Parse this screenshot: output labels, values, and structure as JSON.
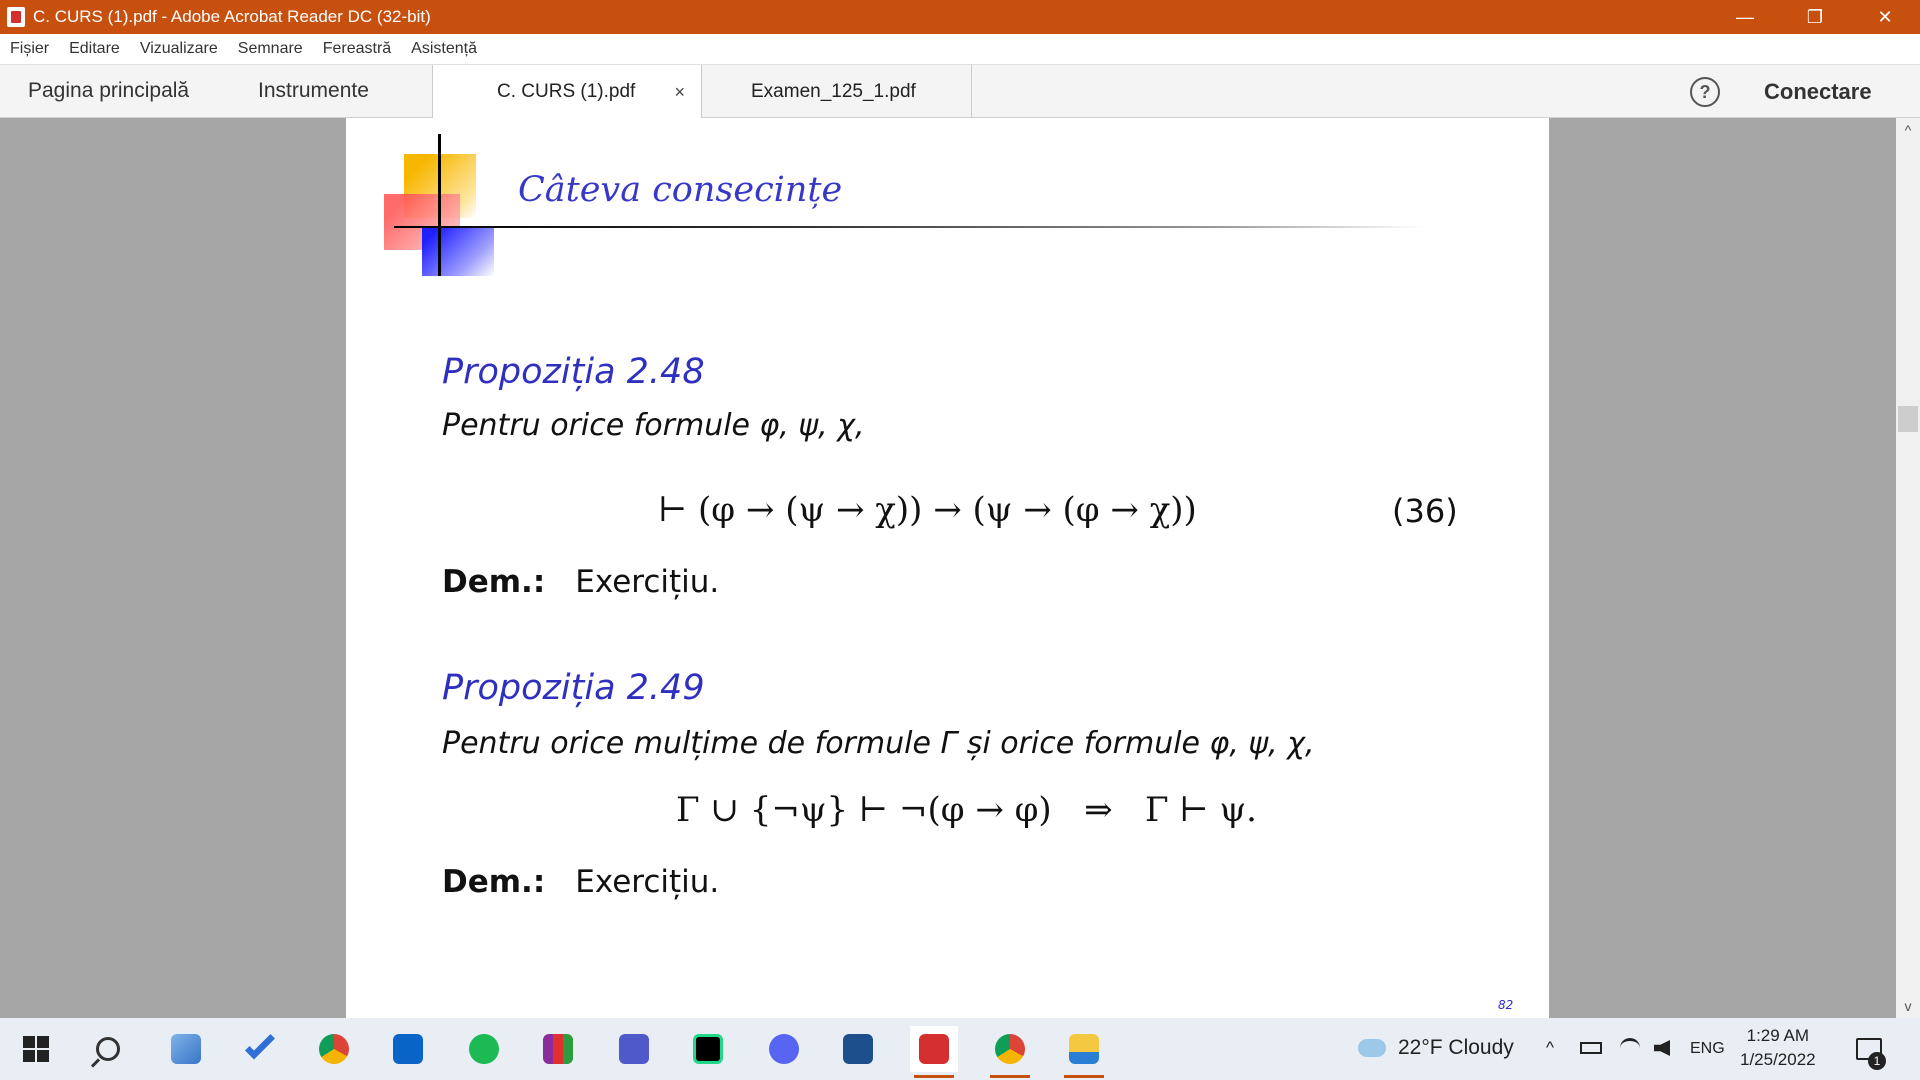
{
  "window": {
    "title": "C. CURS (1).pdf - Adobe Acrobat Reader DC (32-bit)",
    "min": "—",
    "max": "❐",
    "close": "✕"
  },
  "menu": [
    "Fișier",
    "Editare",
    "Vizualizare",
    "Semnare",
    "Fereastră",
    "Asistență"
  ],
  "tabs": {
    "home": "Pagina principală",
    "tools": "Instrumente",
    "documents": [
      {
        "label": "C. CURS (1).pdf",
        "active": true
      },
      {
        "label": "Examen_125_1.pdf",
        "active": false
      }
    ],
    "close_glyph": "×",
    "help": "?",
    "signin": "Conectare"
  },
  "slide": {
    "title": "Câteva consecințe",
    "prop1": {
      "title": "Propoziția 2.48",
      "text": "Pentru orice formule φ, ψ, χ,",
      "formula": "⊢ (φ → (ψ → χ)) → (ψ → (φ → χ))",
      "eqnum": "(36)",
      "dem_label": "Dem.:",
      "dem_text": "Exercițiu."
    },
    "prop2": {
      "title": "Propoziția 2.49",
      "text": "Pentru orice mulțime de formule Γ și orice formule φ, ψ, χ,",
      "formula": "Γ ∪ {¬ψ} ⊢ ¬(φ → φ)   ⇒   Γ ⊢ ψ.",
      "dem_label": "Dem.:",
      "dem_text": "Exercițiu."
    },
    "page_number": "82"
  },
  "scroll": {
    "up": "^",
    "down": "v"
  },
  "taskbar": {
    "icons": [
      "start-icon",
      "search-icon",
      "pc-icon",
      "todo-icon",
      "chrome-icon",
      "outlook-icon",
      "spotify-icon",
      "winrar-icon",
      "teams-icon",
      "pycharm-icon",
      "discord-icon",
      "virtualbox-icon",
      "acrobat-icon",
      "chrome-profile-icon",
      "file-explorer-icon"
    ],
    "weather": "22°F  Cloudy",
    "caret": "^",
    "lang": "ENG",
    "time": "1:29 AM",
    "date": "1/25/2022",
    "notif_count": "1"
  },
  "colors": {
    "titlebar": "#c8500f",
    "slide_title": "#3838c8",
    "prop_title": "#3030c0"
  }
}
